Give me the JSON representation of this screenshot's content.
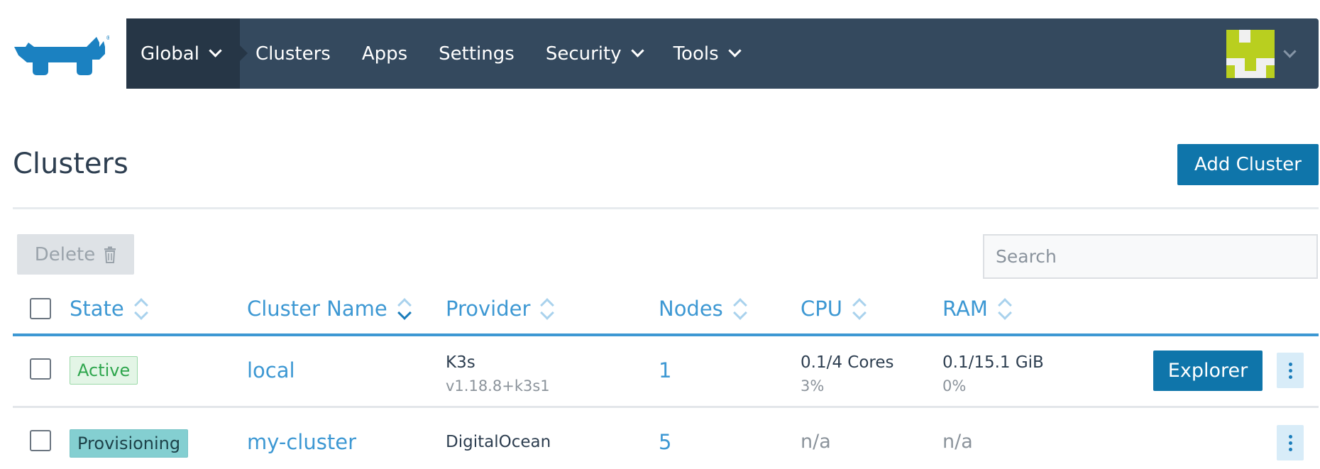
{
  "nav": {
    "global_label": "Global",
    "items": [
      {
        "label": "Clusters",
        "dropdown": false
      },
      {
        "label": "Apps",
        "dropdown": false
      },
      {
        "label": "Settings",
        "dropdown": false
      },
      {
        "label": "Security",
        "dropdown": true
      },
      {
        "label": "Tools",
        "dropdown": true
      }
    ]
  },
  "page": {
    "title": "Clusters",
    "add_button": "Add Cluster",
    "delete_button": "Delete",
    "search_placeholder": "Search"
  },
  "table": {
    "headers": [
      "State",
      "Cluster Name",
      "Provider",
      "Nodes",
      "CPU",
      "RAM"
    ],
    "rows": [
      {
        "state": "Active",
        "name": "local",
        "provider": "K3s",
        "provider_version": "v1.18.8+k3s1",
        "nodes": "1",
        "cpu": "0.1/4 Cores",
        "cpu_pct": "3%",
        "ram": "0.1/15.1 GiB",
        "ram_pct": "0%",
        "action": "Explorer"
      },
      {
        "state": "Provisioning",
        "name": "my-cluster",
        "provider": "DigitalOcean",
        "nodes": "5",
        "cpu": "n/a",
        "ram": "n/a"
      }
    ]
  },
  "colors": {
    "nav_bg": "#34495e",
    "nav_active_bg": "#263646",
    "primary": "#0f75aa",
    "link": "#3d98d3",
    "logo": "#1b81c1",
    "active_text": "#2fa64e",
    "provisioning_bg": "#84cfd1"
  }
}
